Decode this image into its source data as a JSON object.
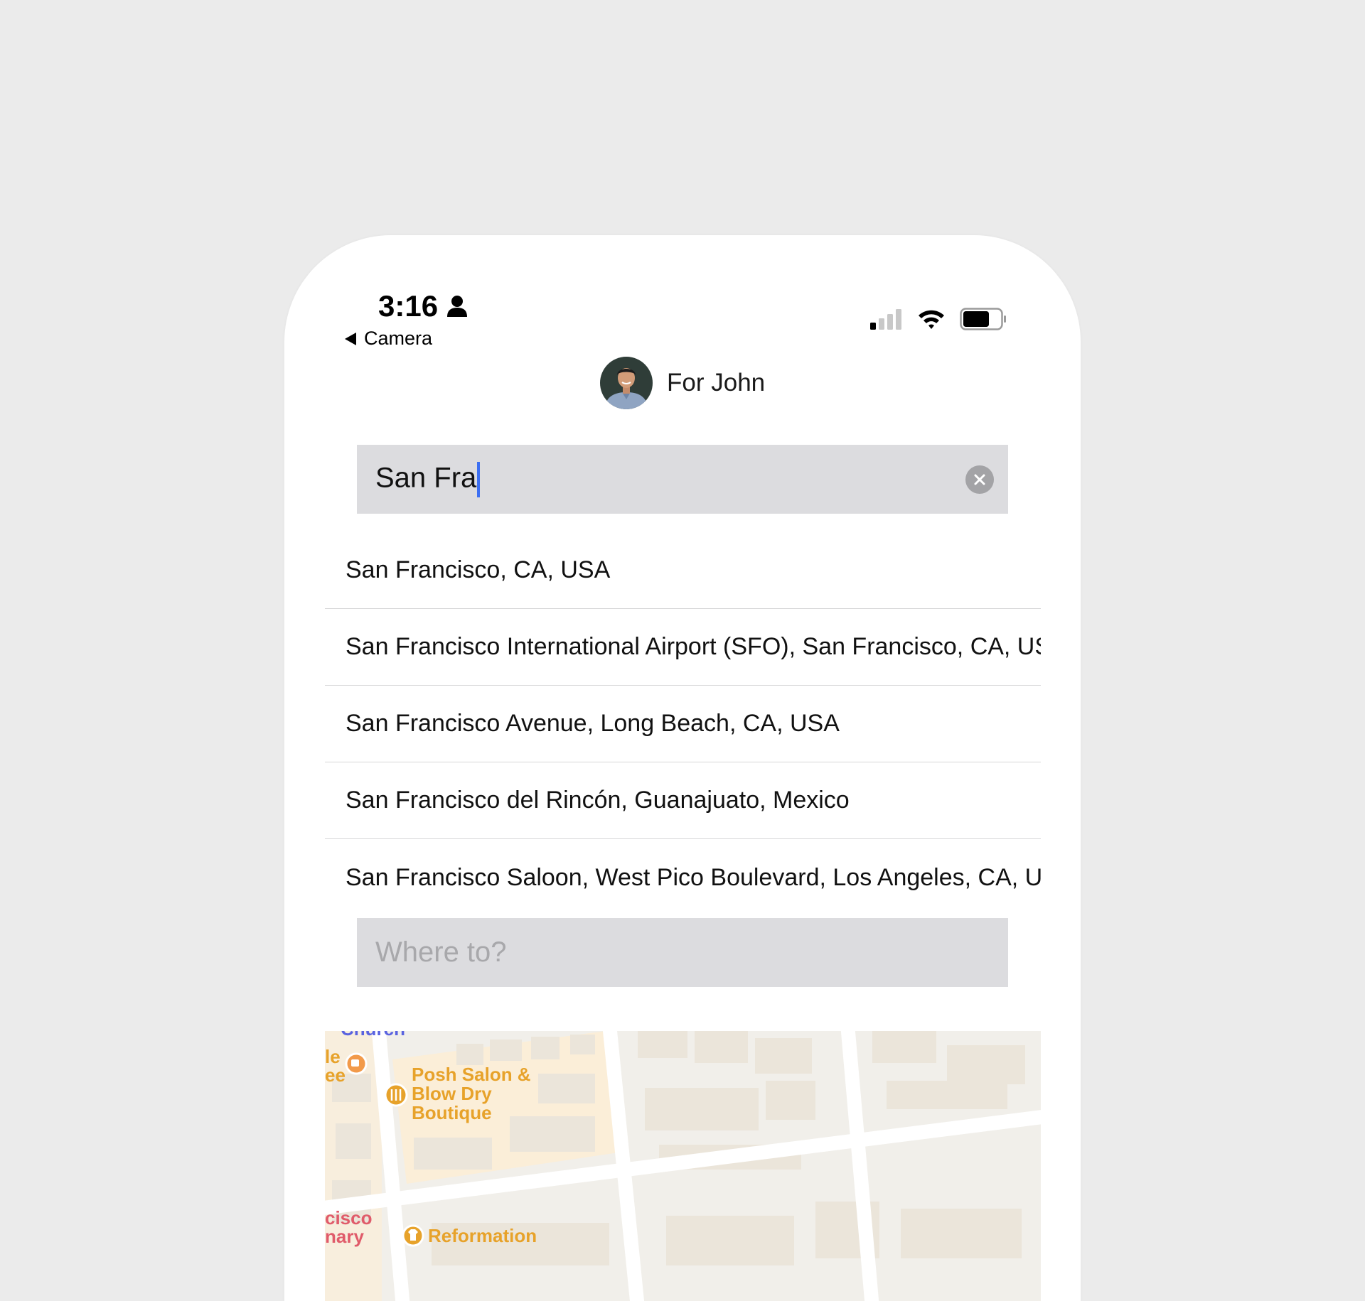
{
  "status_bar": {
    "time": "3:16",
    "back_label": "Camera"
  },
  "recipient": {
    "label": "For John"
  },
  "search": {
    "value": "San Fra"
  },
  "results": [
    {
      "label": "San Francisco, CA, USA"
    },
    {
      "label": "San Francisco International Airport (SFO), San Francisco, CA, USA"
    },
    {
      "label": "San Francisco Avenue, Long Beach, CA, USA"
    },
    {
      "label": "San Francisco del Rincón, Guanajuato, Mexico"
    },
    {
      "label": "San Francisco Saloon, West Pico Boulevard, Los Angeles, CA, USA"
    }
  ],
  "destination": {
    "placeholder": "Where to?",
    "value": ""
  },
  "map": {
    "labels": {
      "church": "Church",
      "cafe": "le\nee",
      "salon": "Posh Salon &\nBlow Dry\nBoutique",
      "cisco": "cisco\nnary",
      "reformation": "Reformation"
    }
  },
  "colors": {
    "caret": "#3c6ff2",
    "field_bg": "#dcdcdf",
    "map_poi_orange": "#e7a22a",
    "map_poi_red": "#e05b6a",
    "map_label_blue": "#5a63e0"
  }
}
